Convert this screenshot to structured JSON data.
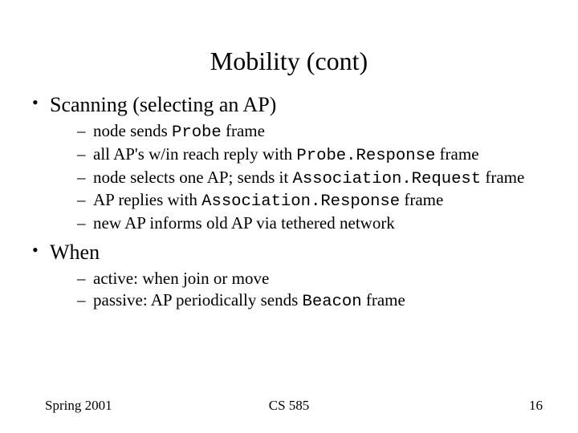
{
  "title": "Mobility (cont)",
  "bullets": {
    "scanning": {
      "label": "Scanning (selecting an AP)",
      "sub": {
        "s1a": "node sends ",
        "s1code": "Probe",
        "s1b": " frame",
        "s2a": "all AP's w/in reach reply with ",
        "s2code": "Probe.Response",
        "s2b": " frame",
        "s3a": "node selects one AP; sends it ",
        "s3code": "Association.Request",
        "s3b": " frame",
        "s4a": "AP replies with ",
        "s4code": "Association.Response",
        "s4b": " frame",
        "s5": "new AP informs old AP via tethered network"
      }
    },
    "when": {
      "label": "When",
      "sub": {
        "w1": "active: when join or move",
        "w2a": "passive: AP periodically sends ",
        "w2code": "Beacon",
        "w2b": " frame"
      }
    }
  },
  "footer": {
    "left": "Spring 2001",
    "center": "CS 585",
    "right": "16"
  }
}
